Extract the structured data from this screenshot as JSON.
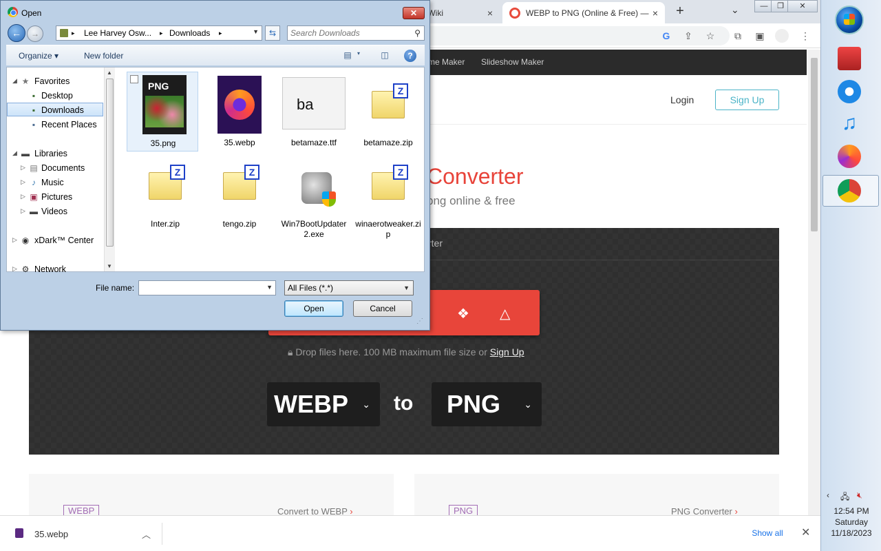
{
  "browser": {
    "tabs": [
      {
        "title": "er Lore Wiki",
        "close": "×"
      },
      {
        "title": "WEBP to PNG (Online & Free) —",
        "close": "×"
      }
    ],
    "new_tab": "+",
    "tab_search": "⌄",
    "window_controls": {
      "minimize": "—",
      "maximize": "❐",
      "close": "✕"
    },
    "site_nav": [
      "me Maker",
      "Slideshow Maker"
    ],
    "header": {
      "login": "Login",
      "signup": "Sign Up"
    },
    "hero": {
      "title": "Converter",
      "subtitle": "png online & free"
    },
    "panel": {
      "tab_label": "rter",
      "drop_note_prefix": "Drop files here. 100 MB maximum file size or",
      "drop_note_link": "Sign Up",
      "from_format": "WEBP",
      "to_word": "to",
      "to_format": "PNG"
    },
    "cards": [
      {
        "badge": "WEBP",
        "link": "Convert to WEBP"
      },
      {
        "badge": "PNG",
        "link": "PNG Converter"
      }
    ],
    "download_bar": {
      "file": "35.webp",
      "show_all": "Show all",
      "close": "✕"
    }
  },
  "taskbar": {
    "time": "12:54 PM",
    "day": "Saturday",
    "date": "11/18/2023"
  },
  "dialog": {
    "title": "Open",
    "close": "✕",
    "breadcrumb": [
      "Lee Harvey Osw...",
      "Downloads"
    ],
    "search_placeholder": "Search Downloads",
    "commands": {
      "organize": "Organize ▾",
      "new_folder": "New folder",
      "help": "?"
    },
    "nav": {
      "favorites": "Favorites",
      "desktop": "Desktop",
      "downloads": "Downloads",
      "recent": "Recent Places",
      "libraries": "Libraries",
      "documents": "Documents",
      "music": "Music",
      "pictures": "Pictures",
      "videos": "Videos",
      "xdark": "xDark™ Center",
      "network": "Network"
    },
    "files": [
      {
        "name": "35.png"
      },
      {
        "name": "35.webp"
      },
      {
        "name": "betamaze.ttf"
      },
      {
        "name": "betamaze.zip"
      },
      {
        "name": "Inter.zip"
      },
      {
        "name": "tengo.zip"
      },
      {
        "name": "Win7BootUpdater2.exe"
      },
      {
        "name": "winaerotweaker.zip"
      }
    ],
    "file_name_label": "File name:",
    "file_name_value": "",
    "filter": "All Files (*.*)",
    "open_button": "Open",
    "cancel_button": "Cancel",
    "png_thumb_label": "PNG",
    "ttf_thumb_label": "ba"
  }
}
